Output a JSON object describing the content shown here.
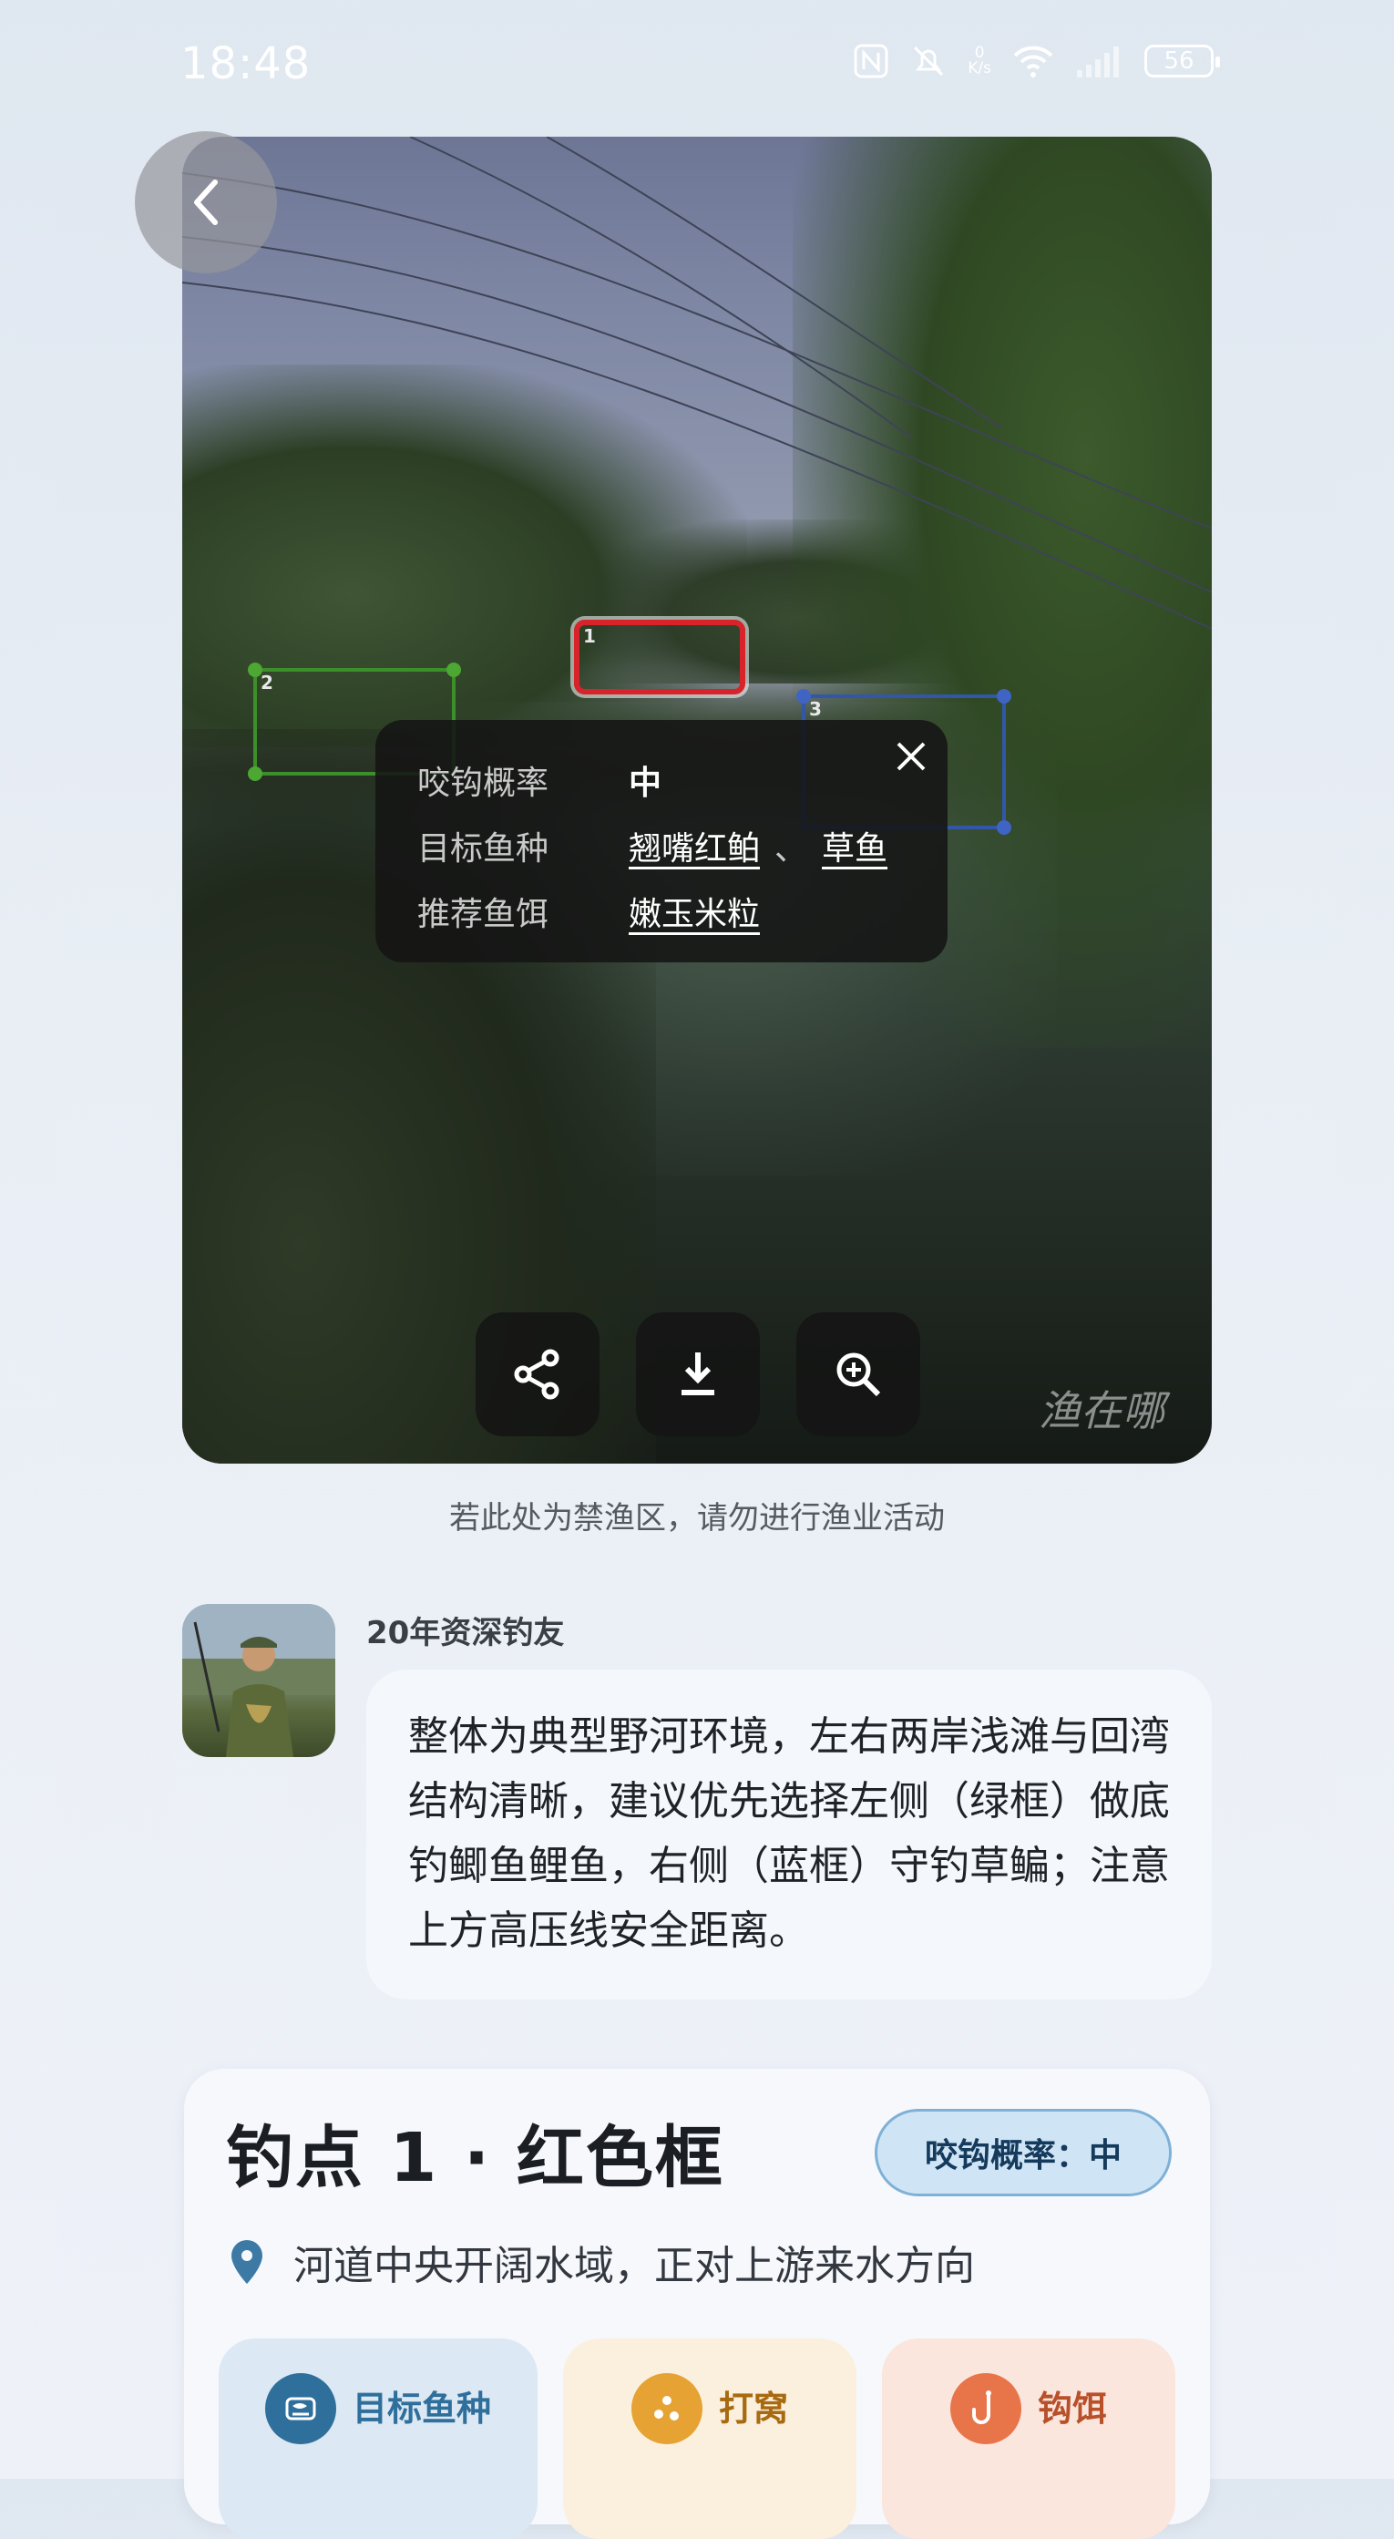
{
  "status_bar": {
    "time": "18:48",
    "net_speed_value": "0",
    "net_speed_unit": "K/s",
    "battery": "56",
    "icons": [
      "nfc-icon",
      "mute-icon",
      "wifi-icon",
      "signal-icon",
      "battery-icon"
    ]
  },
  "photo": {
    "boxes": [
      {
        "number": "1",
        "color": "#d9232a"
      },
      {
        "number": "2",
        "color": "#3c8f2a"
      },
      {
        "number": "3",
        "color": "#3357a8"
      }
    ],
    "popup": {
      "rows": [
        {
          "label": "咬钩概率",
          "value": "中"
        },
        {
          "label": "目标鱼种",
          "values": [
            "翘嘴红鲌",
            "草鱼"
          ],
          "separator": "、"
        },
        {
          "label": "推荐鱼饵",
          "values": [
            "嫩玉米粒"
          ]
        }
      ]
    },
    "actions": [
      "share-icon",
      "download-icon",
      "zoom-in-icon"
    ],
    "watermark": "渔在哪"
  },
  "notice": "若此处为禁渔区，请勿进行渔业活动",
  "expert": {
    "name": "20年资深钓友",
    "comment": "整体为典型野河环境，左右两岸浅滩与回湾结构清晰，建议优先选择左侧（绿框）做底钓鲫鱼鲤鱼，右侧（蓝框）守钓草鳊；注意上方高压线安全距离。"
  },
  "spot": {
    "title": "钓点 1 · 红色框",
    "bite_badge": "咬钩概率：中",
    "location": "河道中央开阔水域，正对上游来水方向",
    "tiles": [
      {
        "label": "目标鱼种",
        "icon": "fish-icon",
        "color": "#2f6f9c",
        "text_color": "#2f6f9c"
      },
      {
        "label": "打窝",
        "icon": "bait-pellets-icon",
        "color": "#e6a232",
        "text_color": "#a86a10"
      },
      {
        "label": "钩饵",
        "icon": "hook-icon",
        "color": "#e8744a",
        "text_color": "#b8502a"
      }
    ]
  },
  "colors": {
    "accent_blue": "#2f6f9c",
    "badge_bg": "#cfe5f6",
    "red_box": "#d9232a",
    "green_box": "#3c8f2a",
    "blue_box": "#3357a8"
  }
}
